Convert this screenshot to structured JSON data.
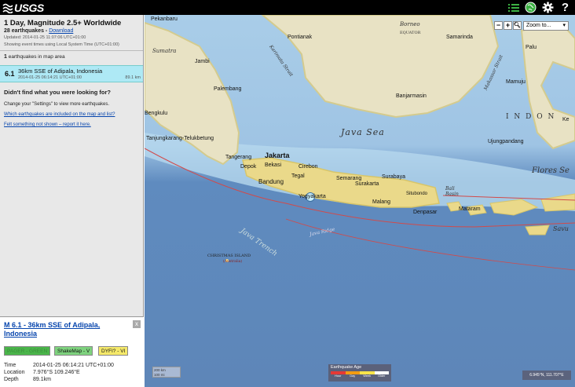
{
  "header": {
    "logo_text": "USGS",
    "icons": [
      "list-icon",
      "globe-icon",
      "gear-icon",
      "help-icon"
    ],
    "help_glyph": "?"
  },
  "panel": {
    "title": "1 Day, Magnitude 2.5+ Worldwide",
    "count_text": "28 earthquakes - ",
    "download_label": "Download",
    "updated": "Updated: 2014-01-25 11:07:06 UTC+01:00",
    "timezone_note": "Showing event times using Local System Time (UTC+01:00)",
    "in_map_count": "1",
    "in_map_text": " earthquakes in map area",
    "earthquake": {
      "magnitude": "6.1",
      "place": "36km SSE of Adipala, Indonesia",
      "time": "2014-01-25 06:14:21 UTC+01:00",
      "distance": "89.1 km"
    },
    "didnt_find": "Didn't find what you were looking for?",
    "settings_note": "Change your \"Settings\" to view more earthquakes.",
    "link_included": "Which earthquakes are included on the map and list?",
    "link_felt": "Felt something not shown – report it here."
  },
  "detail": {
    "title": "M 6.1 - 36km SSE of Adipala, Indonesia",
    "close_label": "x",
    "pager_label": "PAGER - GREEN",
    "shakemap_label": "ShakeMap - V",
    "dyfi_label": "DYFI? - VI",
    "time_label": "Time",
    "time_value": "2014-01-25 06:14:21 UTC+01:00",
    "location_label": "Location",
    "location_value": "7.976°S 109.246°E",
    "depth_label": "Depth",
    "depth_value": "89.1km"
  },
  "map": {
    "zoom_out": "−",
    "zoom_in": "+",
    "zoom_to": "Zoom to...",
    "scale_top": "200 km",
    "scale_bottom": "100 mi",
    "legend_title": "Earthquake Age",
    "legend_labels": [
      "Hour",
      "Day",
      "Week",
      "Older"
    ],
    "coords": "6.945°N, 111.707°E",
    "labels": {
      "java_sea": "Java Sea",
      "flores_sea": "Flores Se",
      "bali_basin": "Bali Basin",
      "java_ridge": "Java Ridge",
      "java_trench": "Java Trench",
      "sumatra": "Sumatra",
      "borneo": "Borneo",
      "equator": "EQUATOR",
      "karimata": "Karimata Strait",
      "makassar": "Makassar Strait",
      "indon": "I N D O N",
      "savu": "Savu",
      "christmas": "CHRISTMAS ISLAND",
      "christmas_sub": "(Australia)"
    },
    "cities": {
      "pekanbaru": "Pekanbaru",
      "pontianak": "Pontianak",
      "samarinda": "Samarinda",
      "jambi": "Jambi",
      "palembang": "Palembang",
      "bengkulu": "Bengkulu",
      "banjarmasin": "Banjarmasin",
      "tanjungkarang": "Tanjungkarang-Telukbetung",
      "jakarta": "Jakarta",
      "tangerang": "Tangerang",
      "depok": "Depok",
      "bekasi": "Bekasi",
      "bandung": "Bandung",
      "cirebon": "Cirebon",
      "tegal": "Tegal",
      "semarang": "Semarang",
      "surakarta": "Surakarta",
      "surabaya": "Surabaya",
      "yogyakarta": "Yogyakarta",
      "malang": "Malang",
      "situbondo": "Situbondo",
      "denpasar": "Denpasar",
      "mataram": "Mataram",
      "ujungpandang": "Ujungpandang",
      "palu": "Palu",
      "mamuju": "Mamuju",
      "kendari": "Ke"
    }
  },
  "colors": {
    "pager_green": "#4ab54a",
    "shakemap_bg": "#7ed27e",
    "dyfi_bg": "#f5e96a",
    "row_highlight": "#aee9f5",
    "link": "#0645ad",
    "plate_line": "#d24a4a",
    "epicenter": "#c8f0ff"
  }
}
